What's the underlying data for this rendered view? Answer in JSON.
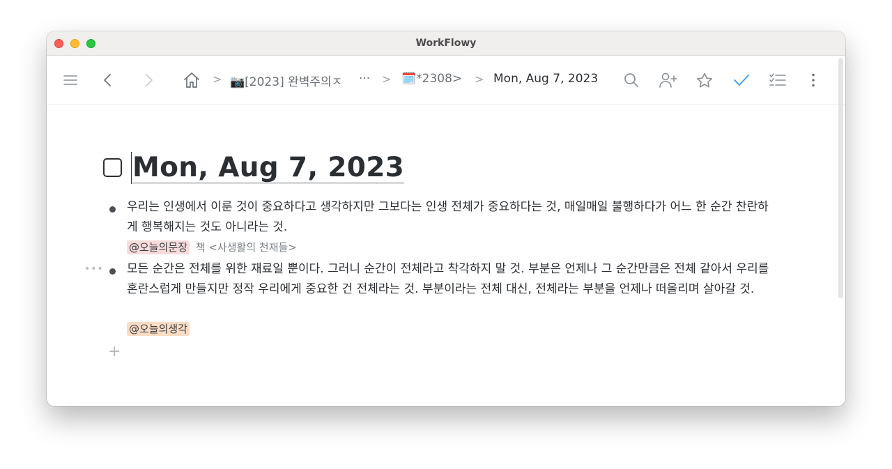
{
  "window": {
    "title": "WorkFlowy"
  },
  "toolbar": {
    "menu_icon": "hamburger-icon",
    "back_icon": "chevron-left-icon",
    "forward_icon": "chevron-right-icon",
    "home_icon": "home-icon",
    "breadcrumbs": {
      "item1": "📷[2023] 완벽주의ㅈ",
      "ellipsis": "···",
      "item2": "🗓️*2308>",
      "current": "Mon, Aug 7, 2023",
      "separator": ">"
    },
    "search_icon": "search-icon",
    "share_icon": "add-user-icon",
    "star_icon": "star-icon",
    "check_icon": "check-icon",
    "checklist_icon": "checklist-icon",
    "more_icon": "more-vertical-icon"
  },
  "page": {
    "title": "Mon, Aug 7, 2023",
    "items": [
      {
        "text": "우리는 인생에서 이룬 것이 중요하다고 생각하지만 그보다는 인생 전체가 중요하다는 것, 매일매일 불행하다가 어느 한 순간 찬란하게 행복해지는 것도 아니라는 것.",
        "tag": "@오늘의문장",
        "tag_color": "#f8dcdc",
        "note": "책 <사생활의 천재들>"
      },
      {
        "text": "모든 순간은 전체를 위한 재료일 뿐이다. 그러니 순간이 전체라고 착각하지 말 것. 부분은 언제나 그 순간만큼은 전체 같아서 우리를 혼란스럽게 만들지만 정작 우리에게 중요한 건 전체라는 것. 부분이라는 전체 대신, 전체라는 부분을 언제나 떠올리며 살아갈 것.",
        "tag": "@오늘의생각",
        "tag_color": "#fbdcc4"
      }
    ],
    "add_label": "+",
    "help_label": "?"
  }
}
